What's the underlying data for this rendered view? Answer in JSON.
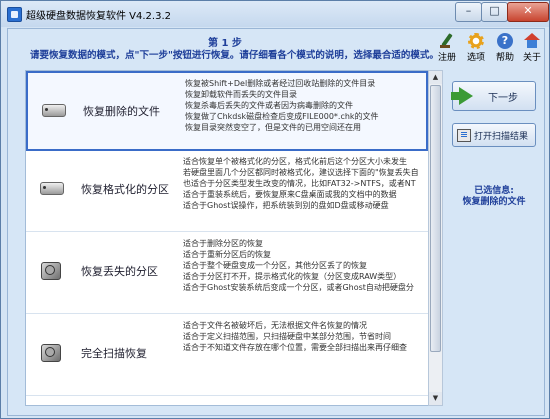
{
  "window": {
    "title": "超级硬盘数据恢复软件 V4.2.3.2",
    "minimize": "–",
    "maximize": "□",
    "close": "✕"
  },
  "header": {
    "step": "第 1 步",
    "instruction": "请要恢复数据的模式，点\"下一步\"按钮进行恢复。请仔细看各个模式的说明，选择最合适的模式。"
  },
  "toolbar": {
    "register": "注册",
    "options": "选项",
    "help": "帮助",
    "about": "关于"
  },
  "modes": [
    {
      "name": "恢复删除的文件",
      "selected": true,
      "icon": "floppy-drive-icon",
      "desc": [
        "恢复被Shift+Del删除或者经过回收站删除的文件目录",
        "恢复卸载软件而丢失的文件目录",
        "恢复杀毒后丢失的文件或者因为病毒删除的文件",
        "恢复做了Chkdsk磁盘检查后变成FILE000*.chk的文件",
        "恢复目录突然变空了，但是文件的已用空间还在用"
      ]
    },
    {
      "name": "恢复格式化的分区",
      "selected": false,
      "icon": "floppy-drive-icon",
      "desc": [
        "适合恢复单个被格式化的分区，格式化前后这个分区大小未发生",
        "若硬盘里面几个分区都同时被格式化，建议选择下面的\"恢复丢失自",
        "也适合于分区类型发生改变的情况，比如FAT32->NTFS，或者NT",
        "适合于重装系统后，要恢复原来C盘桌面或我的文档中的数据",
        "适合于Ghost误操作，把系统装到别的盘如D盘或移动硬盘"
      ]
    },
    {
      "name": "恢复丢失的分区",
      "selected": false,
      "icon": "hard-disk-icon",
      "desc": [
        "适合于删除分区的恢复",
        "适合于重新分区后的恢复",
        "适合于整个硬盘变成一个分区，其他分区丢了的恢复",
        "适合于分区打不开，提示格式化的恢复（分区变成RAW类型）",
        "适合于Ghost安装系统后变成一个分区，或者Ghost自动把硬盘分"
      ]
    },
    {
      "name": "完全扫描恢复",
      "selected": false,
      "icon": "hard-disk-icon",
      "desc": [
        "适合于文件名被破坏后，无法根据文件名恢复的情况",
        "适合于定义扫描范围，只扫描硬盘中某部分范围，节省时间",
        "适合于不知道文件存放在哪个位置，需要全部扫描出来再仔细查"
      ]
    }
  ],
  "buttons": {
    "next": "下一步",
    "open_scan": "打开扫描结果"
  },
  "selection": {
    "heading": "已选信息:",
    "value": "恢复删除的文件"
  },
  "scrollbar": {
    "up": "▲",
    "down": "▼"
  }
}
